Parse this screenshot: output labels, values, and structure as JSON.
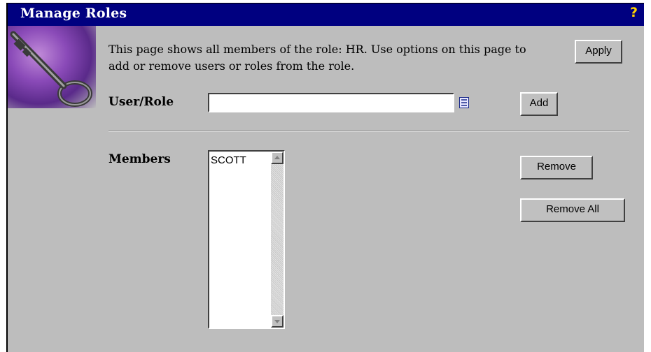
{
  "window": {
    "title": "Manage Roles"
  },
  "description": "This page shows all members of the role: HR. Use options on this page to add or remove users or roles from the role.",
  "form": {
    "user_role_label": "User/Role",
    "user_role_value": "",
    "members_label": "Members",
    "members": [
      "SCOTT"
    ]
  },
  "buttons": {
    "apply": "Apply",
    "add": "Add",
    "remove": "Remove",
    "remove_all": "Remove All"
  },
  "icons": {
    "help": "?",
    "help_icon": "help-icon",
    "key_image": "key-icon",
    "list_picker": "list-picker-icon"
  },
  "colors": {
    "titlebar": "#000080",
    "help": "#ffd400",
    "panel": "#bdbdbd"
  }
}
